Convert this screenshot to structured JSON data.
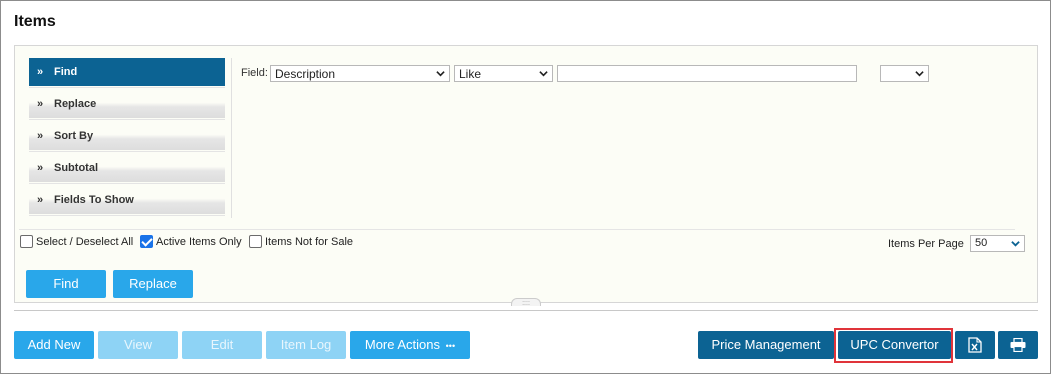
{
  "page": {
    "title": "Items"
  },
  "menu": {
    "items": [
      {
        "chevron": "»",
        "label": "Find"
      },
      {
        "chevron": "»",
        "label": "Replace"
      },
      {
        "chevron": "»",
        "label": "Sort By"
      },
      {
        "chevron": "»",
        "label": "Subtotal"
      },
      {
        "chevron": "»",
        "label": "Fields To Show"
      }
    ],
    "active": "Find"
  },
  "filter": {
    "field_label": "Field:",
    "field_select": "Description",
    "operator_select": "Like",
    "value_input": "",
    "extra_select": ""
  },
  "options": {
    "select_all": {
      "label": "Select / Deselect All",
      "checked": false
    },
    "active_only": {
      "label": "Active Items Only",
      "checked": true
    },
    "not_for_sale": {
      "label": "Items Not for Sale",
      "checked": false
    },
    "items_per_page_label": "Items Per Page",
    "items_per_page": "50"
  },
  "actions": {
    "find": "Find",
    "replace": "Replace"
  },
  "toolbar": {
    "add_new": "Add New",
    "view": "View",
    "edit": "Edit",
    "item_log": "Item Log",
    "more_actions": "More Actions",
    "more_dots": "•••",
    "price_management": "Price Management",
    "upc_convertor": "UPC Convertor",
    "excel_icon": "excel-export-icon",
    "print_icon": "printer-icon"
  },
  "colors": {
    "primary": "#29a7ea",
    "primary_disabled": "#8ed3f5",
    "dark": "#0c6393",
    "highlight": "#e0343a"
  }
}
